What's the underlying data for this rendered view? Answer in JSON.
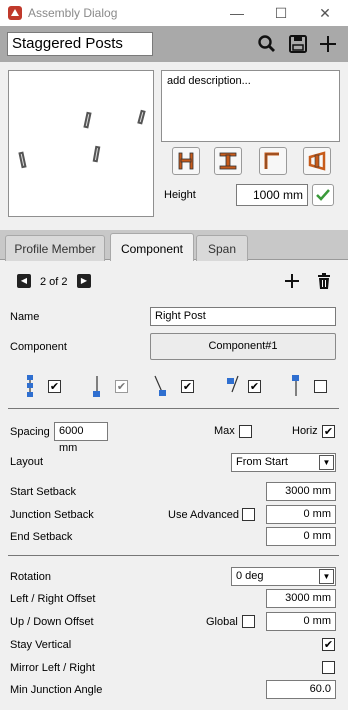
{
  "window": {
    "title": "Assembly Dialog",
    "minimize": "—",
    "maximize": "☐",
    "close": "✕"
  },
  "header": {
    "name_value": "Staggered Posts"
  },
  "description": {
    "value": "add description..."
  },
  "height": {
    "label": "Height",
    "value": "1000 mm"
  },
  "tabs": [
    {
      "label": "Profile Member",
      "active": false
    },
    {
      "label": "Component",
      "active": true
    },
    {
      "label": "Span",
      "active": false
    }
  ],
  "pager": {
    "text": "2 of 2",
    "prev": "◀",
    "next": "▶"
  },
  "component": {
    "name_label": "Name",
    "name_value": "Right Post",
    "component_label": "Component",
    "component_value": "Component#1"
  },
  "placement_options": [
    {
      "icon": "stacked-posts-icon",
      "checked": true
    },
    {
      "icon": "single-post-icon",
      "checked": true,
      "disabled": true
    },
    {
      "icon": "left-diagonal-post-icon",
      "checked": true
    },
    {
      "icon": "right-diagonal-post-icon",
      "checked": true
    },
    {
      "icon": "top-post-icon",
      "checked": false
    }
  ],
  "spacing": {
    "label": "Spacing",
    "value": "6000 mm",
    "max_label": "Max",
    "max_checked": false,
    "horiz_label": "Horiz",
    "horiz_checked": true
  },
  "layout": {
    "label": "Layout",
    "value": "From Start"
  },
  "start_setback": {
    "label": "Start Setback",
    "value": "3000 mm"
  },
  "junction_setback": {
    "label": "Junction Setback",
    "advanced_label": "Use Advanced",
    "advanced_checked": false,
    "value": "0 mm"
  },
  "end_setback": {
    "label": "End Setback",
    "value": "0 mm"
  },
  "rotation": {
    "label": "Rotation",
    "value": "0 deg"
  },
  "lr_offset": {
    "label": "Left / Right Offset",
    "value": "3000 mm"
  },
  "ud_offset": {
    "label": "Up / Down Offset",
    "global_label": "Global",
    "global_checked": false,
    "value": "0 mm"
  },
  "stay_vertical": {
    "label": "Stay Vertical",
    "checked": true
  },
  "mirror": {
    "label": "Mirror Left / Right",
    "checked": false
  },
  "min_junction": {
    "label": "Min Junction Angle",
    "value": "60.0"
  },
  "colors": {
    "accent_green": "#3a9a3a",
    "post_blue": "#2f6fd0",
    "app_red": "#c0392b"
  }
}
